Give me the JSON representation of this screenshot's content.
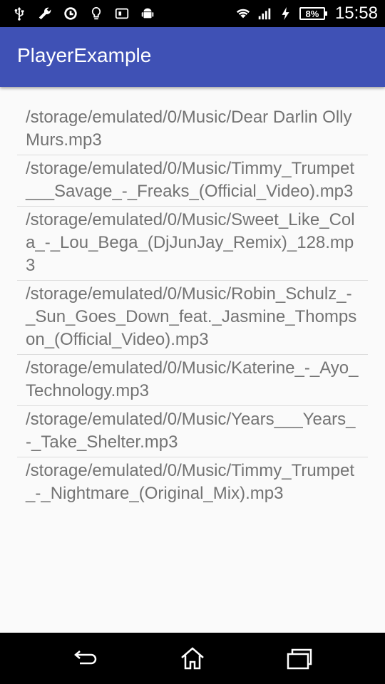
{
  "status_bar": {
    "battery_text": "8%",
    "time": "15:58",
    "icons_left": [
      "usb-icon",
      "wrench-icon",
      "sync-icon",
      "lightbulb-icon",
      "sim-card-icon",
      "android-icon"
    ],
    "icons_right": [
      "wifi-icon",
      "signal-icon",
      "charging-icon",
      "battery-icon"
    ]
  },
  "app_bar": {
    "title": "PlayerExample"
  },
  "songs": [
    "/storage/emulated/0/Music/Dear Darlin Olly Murs.mp3",
    "/storage/emulated/0/Music/Timmy_Trumpet___Savage_-_Freaks_(Official_Video).mp3",
    "/storage/emulated/0/Music/Sweet_Like_Cola_-_Lou_Bega_(DjJunJay_Remix)_128.mp3",
    "/storage/emulated/0/Music/Robin_Schulz_-_Sun_Goes_Down_feat._Jasmine_Thompson_(Official_Video).mp3",
    "/storage/emulated/0/Music/Katerine_-_Ayo_Technology.mp3",
    "/storage/emulated/0/Music/Years___Years_-_Take_Shelter.mp3",
    "/storage/emulated/0/Music/Timmy_Trumpet_-_Nightmare_(Original_Mix).mp3"
  ],
  "nav_bar": {
    "buttons": [
      "back-icon",
      "home-icon",
      "recents-icon"
    ]
  },
  "colors": {
    "primary": "#3f51b5",
    "text": "#737373",
    "divider": "#dcdcdc",
    "background": "#fafafa"
  }
}
